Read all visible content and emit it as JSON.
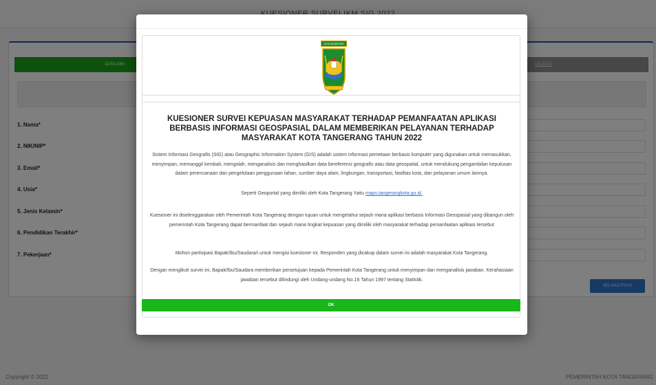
{
  "page": {
    "title": "KUESIONER SURVEI IKM SIG 2022",
    "steps": {
      "active": "DATA DIRI",
      "last": "SELESAI"
    },
    "fields": [
      {
        "label": "1. Nama*"
      },
      {
        "label": "2. NIK/NIP*"
      },
      {
        "label": "3. Email*"
      },
      {
        "label": "4. Usia*"
      },
      {
        "label": "5. Jenis Kelamin*"
      },
      {
        "label": "6. Pendidikan Terakhir*"
      },
      {
        "label": "7. Pekerjaan*"
      }
    ],
    "next_label": "SELANJUTNYA",
    "footer_left": "Copyright © 2022",
    "footer_right": "PEMERINTAH KOTA TANGERANG"
  },
  "modal": {
    "logo_banner": "KOTA TANGERANG",
    "heading": "KUESIONER SURVEI KEPUASAN MASYARAKAT TERHADAP PEMANFAATAN APLIKASI BERBASIS INFORMASI GEOSPASIAL DALAM MEMBERIKAN PELAYANAN TERHADAP MASYARAKAT KOTA TANGERANG TAHUN 2022",
    "p1": "Sistem Informasi Geografis (SIG) atau Geographic Information System (GIS) adalah sistem informasi pemetaan berbasis komputer yang digunakan untuk memasukkan, menyimpan, memanggil kembali, mengolah, menganalisis dan menghasilkan data bereferensi geografis atau data geospatial, untuk mendukung pengambilan keputusan dalam perencanaan dan pengelolaan penggunaan lahan, sumber daya alam, lingkungan, transportasi, fasilitas kota, dan pelayanan umum lainnya.",
    "p1b_prefix": "Seperti Geoportal yang dimiliki oleh Kota Tangerang Yaitu ",
    "p1b_link": "maps.tangerangkota.go.id.",
    "p2": "Kuesioner ini diselenggarakan oleh Pemerintah Kota Tangerang dengan tujuan untuk mengetahui sejauh mana aplikasi berbasis Informasi Geospasial yang dibangun oleh pemerintah Kota Tangerang dapat bermanfaat dan sejauh mana tingkat kepuasan yang dimiliki oleh masyarakat terhadap pemanfaatan aplikasi tersebut",
    "p3": "Mohon partisipasi Bapak/Ibu/Saudara/i untuk mengisi kuesioner ini. Responden yang dicakup dalam survei ini adalah masyarakat Kota Tangerang.",
    "p4": "Dengan mengikuti survei ini, Bapak/Ibu/Saudara memberikan persetujuan kepada Pemerintah Kota Tangerang untuk menyimpan dan menganalisis jawaban. Kerahasiaan jawaban tersebut dilindungi oleh Undang-undang No.16 Tahun 1997 tentang Statistik.",
    "ok_label": "OK"
  },
  "colors": {
    "accent_green": "#1ab71a",
    "step_green": "#1aa31a",
    "button_blue": "#2e74c9",
    "header_blue": "#1f4fa8"
  }
}
